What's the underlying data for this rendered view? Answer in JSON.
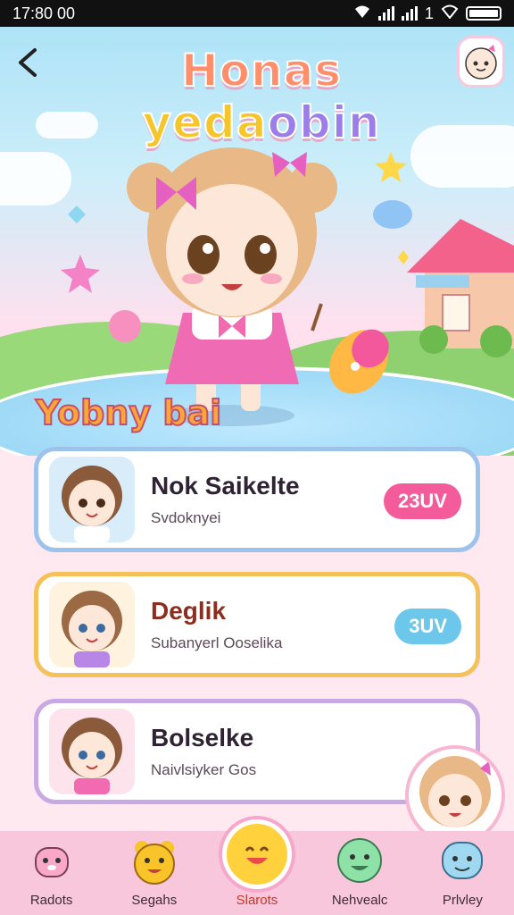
{
  "status_bar": {
    "time": "17:80 00",
    "signal_label": "1"
  },
  "header": {
    "title_parts": [
      {
        "text": "Honas",
        "color": "#ff8f6b"
      },
      {
        "text": " ",
        "color": "#ffffff"
      },
      {
        "text": "yeda",
        "color": "#f5c52a"
      },
      {
        "text": "obin",
        "color": "#9b7ee8"
      }
    ]
  },
  "section_heading": "Yobny bai",
  "cards": [
    {
      "name": "Nok Saikelte",
      "subtitle": "Svdoknyei",
      "badge": "23UV",
      "badge_color": "#f45b9a",
      "border": "#9ec3ea"
    },
    {
      "name": "Deglik",
      "subtitle": "Subanyerl Ooselika",
      "badge": "3UV",
      "badge_color": "#6cc7ea",
      "border": "#f4c15a"
    },
    {
      "name": "Bolselke",
      "subtitle": "Naivlsiyker Gos",
      "badge": "",
      "badge_color": "#ffffff",
      "border": "#c8a9e4"
    }
  ],
  "nav": [
    {
      "label": "Radots",
      "icon": "pink-bunny-icon",
      "active": false
    },
    {
      "label": "Segahs",
      "icon": "yellow-bear-icon",
      "active": false
    },
    {
      "label": "Slarots",
      "icon": "smiley-star-icon",
      "active": true
    },
    {
      "label": "Nehvealc",
      "icon": "green-face-icon",
      "active": false
    },
    {
      "label": "Prlvley",
      "icon": "blue-face-icon",
      "active": false
    }
  ],
  "colors": {
    "accent_pink": "#f45b9a",
    "nav_bg": "#f9c7dc",
    "heading_orange": "#f7a83a"
  }
}
